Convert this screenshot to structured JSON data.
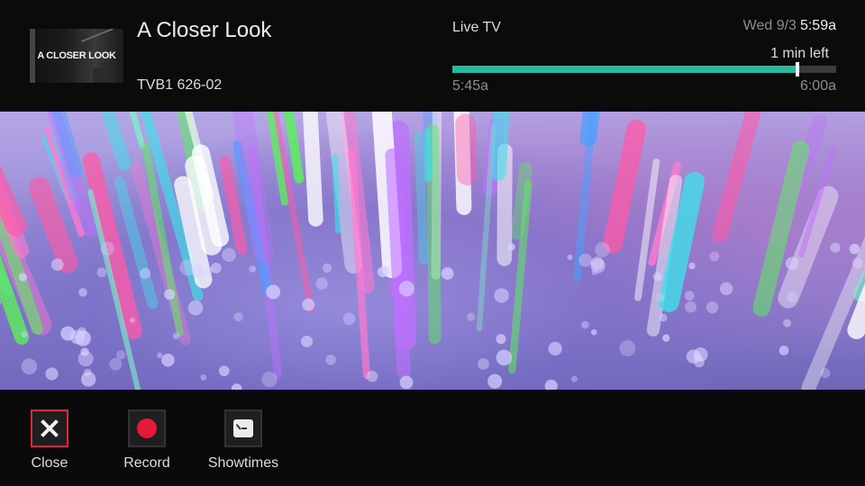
{
  "program": {
    "title": "A Closer Look",
    "thumbnail_text": "A CLOSER LOOK",
    "channel": "TVB1 626-02"
  },
  "status": {
    "source": "Live TV",
    "date": "Wed 9/3",
    "time": "5:59a",
    "time_left": "1 min left",
    "start": "5:45a",
    "end": "6:00a",
    "progress": 0.9,
    "accent_color": "#27b9a0"
  },
  "actions": [
    {
      "label": "Close",
      "icon": "close-icon",
      "selected": true
    },
    {
      "label": "Record",
      "icon": "record-icon",
      "color": "#e41b36"
    },
    {
      "label": "Showtimes",
      "icon": "clock-icon"
    }
  ],
  "colors": {
    "selection_border": "#e0263a",
    "background": "#0b0b0c"
  }
}
